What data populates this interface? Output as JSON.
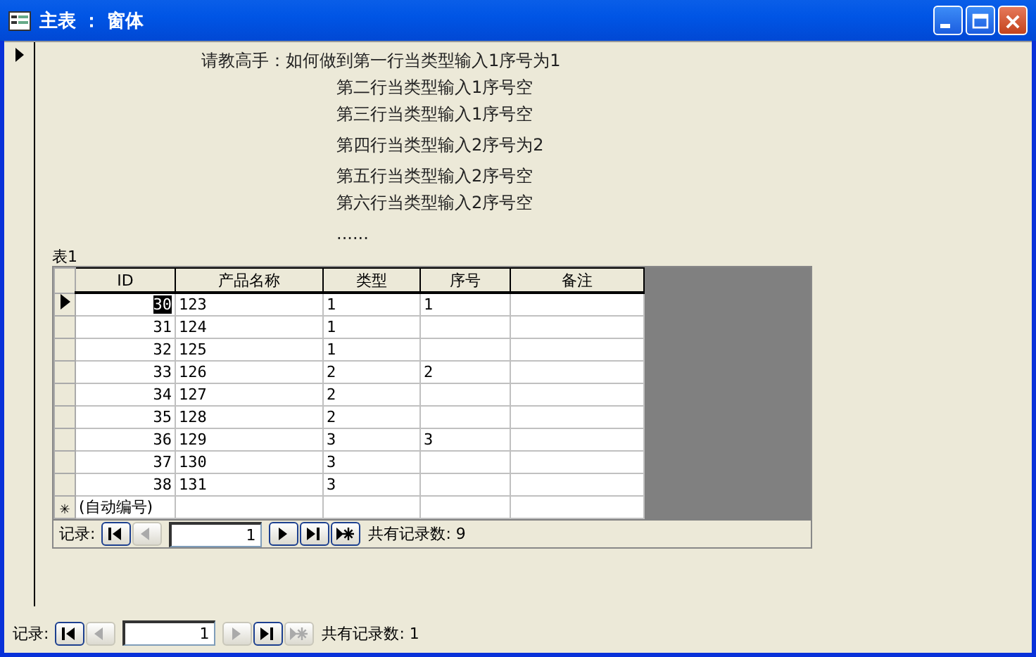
{
  "window": {
    "title": "主表 ： 窗体"
  },
  "note_lines": [
    {
      "text": "请教高手：如何做到第一行当类型输入1序号为1",
      "indent": false
    },
    {
      "text": "第二行当类型输入1序号空",
      "indent": true
    },
    {
      "text": "第三行当类型输入1序号空",
      "indent": true
    },
    {
      "text": "第四行当类型输入2序号为2",
      "indent": true
    },
    {
      "text": "第五行当类型输入2序号空",
      "indent": true
    },
    {
      "text": "第六行当类型输入2序号空",
      "indent": true
    },
    {
      "text": "......",
      "indent": true
    }
  ],
  "subform": {
    "label": "表1",
    "columns": [
      "ID",
      "产品名称",
      "类型",
      "序号",
      "备注"
    ],
    "rows": [
      {
        "cells": [
          "30",
          "123",
          "1",
          "1",
          ""
        ],
        "selected": true
      },
      {
        "cells": [
          "31",
          "124",
          "1",
          "",
          ""
        ],
        "selected": false
      },
      {
        "cells": [
          "32",
          "125",
          "1",
          "",
          ""
        ],
        "selected": false
      },
      {
        "cells": [
          "33",
          "126",
          "2",
          "2",
          ""
        ],
        "selected": false
      },
      {
        "cells": [
          "34",
          "127",
          "2",
          "",
          ""
        ],
        "selected": false
      },
      {
        "cells": [
          "35",
          "128",
          "2",
          "",
          ""
        ],
        "selected": false
      },
      {
        "cells": [
          "36",
          "129",
          "3",
          "3",
          ""
        ],
        "selected": false
      },
      {
        "cells": [
          "37",
          "130",
          "3",
          "",
          ""
        ],
        "selected": false
      },
      {
        "cells": [
          "38",
          "131",
          "3",
          "",
          ""
        ],
        "selected": false
      }
    ],
    "new_row": {
      "marker": "✳",
      "id_placeholder": "(自动编号)"
    },
    "navigation": {
      "label": "记录:",
      "record_number": "1",
      "total": "共有记录数: 9",
      "buttons": [
        {
          "kind": "first",
          "disabled": false
        },
        {
          "kind": "prev",
          "disabled": true
        },
        {
          "kind": "field"
        },
        {
          "kind": "next",
          "disabled": false
        },
        {
          "kind": "last",
          "disabled": false
        },
        {
          "kind": "new",
          "disabled": false
        }
      ]
    }
  },
  "navigation": {
    "label": "记录:",
    "record_number": "1",
    "total": "共有记录数: 1",
    "buttons": [
      {
        "kind": "first",
        "disabled": false
      },
      {
        "kind": "prev",
        "disabled": true
      },
      {
        "kind": "field"
      },
      {
        "kind": "next",
        "disabled": true
      },
      {
        "kind": "last",
        "disabled": false
      },
      {
        "kind": "new",
        "disabled": true
      }
    ]
  }
}
